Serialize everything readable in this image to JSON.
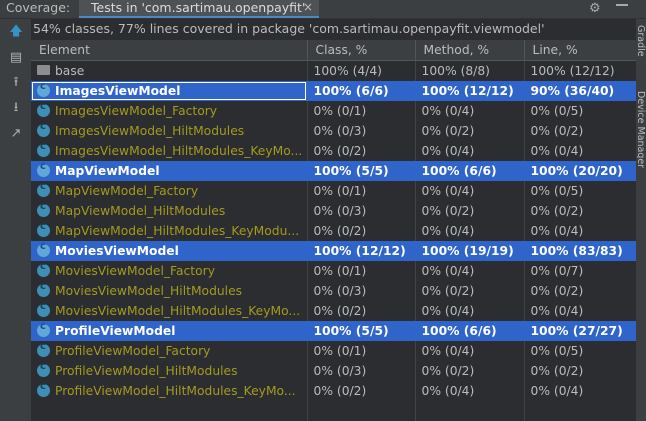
{
  "topbar": {
    "coverage_label": "Coverage:",
    "tab_label": "Tests in 'com.sartimau.openpayfit'",
    "tab_close": "×"
  },
  "summary": "54% classes, 77% lines covered in package 'com.sartimau.openpayfit.viewmodel'",
  "columns": [
    "Element",
    "Class, %",
    "Method, %",
    "Line, %"
  ],
  "rows": [
    {
      "name": "base",
      "cls": "100% (4/4)",
      "method": "100% (8/8)",
      "line": "100% (12/12)",
      "kind": "folder",
      "state": "normal"
    },
    {
      "name": "ImagesViewModel",
      "cls": "100% (6/6)",
      "method": "100% (12/12)",
      "line": "90% (36/40)",
      "kind": "class",
      "state": "selected"
    },
    {
      "name": "ImagesViewModel_Factory",
      "cls": "0% (0/1)",
      "method": "0% (0/4)",
      "line": "0% (0/5)",
      "kind": "class",
      "state": "dim"
    },
    {
      "name": "ImagesViewModel_HiltModules",
      "cls": "0% (0/3)",
      "method": "0% (0/2)",
      "line": "0% (0/2)",
      "kind": "class",
      "state": "dim"
    },
    {
      "name": "ImagesViewModel_HiltModules_KeyMo...",
      "cls": "0% (0/2)",
      "method": "0% (0/4)",
      "line": "0% (0/4)",
      "kind": "class",
      "state": "dim"
    },
    {
      "name": "MapViewModel",
      "cls": "100% (5/5)",
      "method": "100% (6/6)",
      "line": "100% (20/20)",
      "kind": "class",
      "state": "selected"
    },
    {
      "name": "MapViewModel_Factory",
      "cls": "0% (0/1)",
      "method": "0% (0/4)",
      "line": "0% (0/5)",
      "kind": "class",
      "state": "dim"
    },
    {
      "name": "MapViewModel_HiltModules",
      "cls": "0% (0/3)",
      "method": "0% (0/2)",
      "line": "0% (0/2)",
      "kind": "class",
      "state": "dim"
    },
    {
      "name": "MapViewModel_HiltModules_KeyModu...",
      "cls": "0% (0/2)",
      "method": "0% (0/4)",
      "line": "0% (0/4)",
      "kind": "class",
      "state": "dim"
    },
    {
      "name": "MoviesViewModel",
      "cls": "100% (12/12)",
      "method": "100% (19/19)",
      "line": "100% (83/83)",
      "kind": "class",
      "state": "selected"
    },
    {
      "name": "MoviesViewModel_Factory",
      "cls": "0% (0/1)",
      "method": "0% (0/4)",
      "line": "0% (0/7)",
      "kind": "class",
      "state": "dim"
    },
    {
      "name": "MoviesViewModel_HiltModules",
      "cls": "0% (0/3)",
      "method": "0% (0/2)",
      "line": "0% (0/2)",
      "kind": "class",
      "state": "dim"
    },
    {
      "name": "MoviesViewModel_HiltModules_KeyMo...",
      "cls": "0% (0/2)",
      "method": "0% (0/4)",
      "line": "0% (0/4)",
      "kind": "class",
      "state": "dim"
    },
    {
      "name": "ProfileViewModel",
      "cls": "100% (5/5)",
      "method": "100% (6/6)",
      "line": "100% (27/27)",
      "kind": "class",
      "state": "selected"
    },
    {
      "name": "ProfileViewModel_Factory",
      "cls": "0% (0/1)",
      "method": "0% (0/4)",
      "line": "0% (0/5)",
      "kind": "class",
      "state": "dim"
    },
    {
      "name": "ProfileViewModel_HiltModules",
      "cls": "0% (0/3)",
      "method": "0% (0/2)",
      "line": "0% (0/2)",
      "kind": "class",
      "state": "dim"
    },
    {
      "name": "ProfileViewModel_HiltModules_KeyMo...",
      "cls": "0% (0/2)",
      "method": "0% (0/4)",
      "line": "0% (0/4)",
      "kind": "class",
      "state": "dim"
    }
  ],
  "right_strip": [
    "Gradle",
    "Device Manager"
  ],
  "icons": {
    "settings": "gear-icon",
    "hide": "minimize-icon",
    "rerun": "arrow-up-icon",
    "flatten": "flatten-packages-icon",
    "import": "import-icon",
    "export": "export-icon",
    "goto": "navigate-icon"
  },
  "colors": {
    "selection": "#2f65ca",
    "uncovered_text": "#a49a1e",
    "panel_bg": "#2b2d30",
    "header_bg": "#3c3f41"
  }
}
